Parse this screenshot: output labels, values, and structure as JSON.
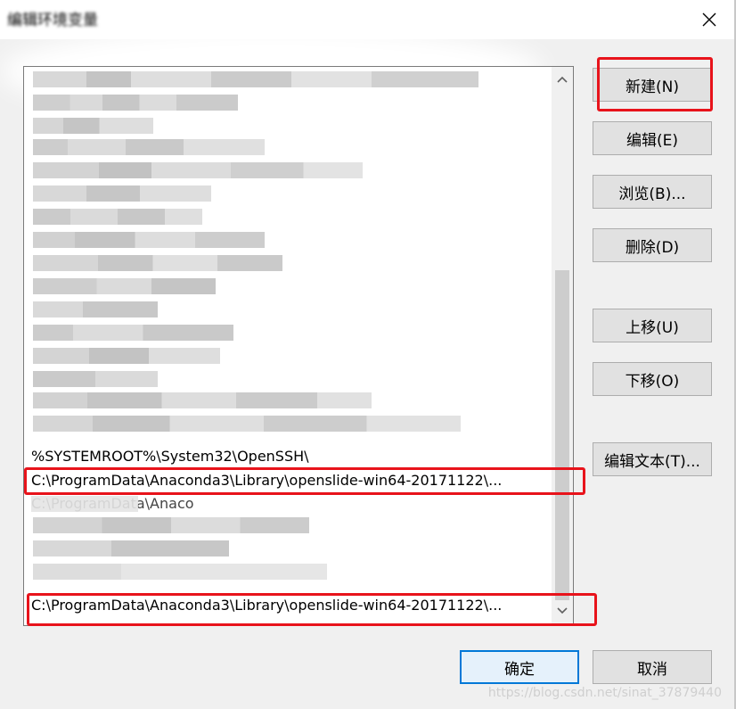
{
  "window": {
    "title": "编辑环境变量",
    "close_icon": "close-icon"
  },
  "path_list": {
    "visible_entries": [
      "%SYSTEMROOT%\\System32\\OpenSSH\\",
      "C:\\ProgramData\\Anaconda3\\Library\\openslide-win64-20171122\\...",
      "C:\\ProgramData\\Anaconda3\\Library\\openslide-win64-20171122\\..."
    ],
    "partial_entry": "C:\\ProgramData\\Anaco",
    "scroll_up_icon": "chevron-up-icon",
    "scroll_down_icon": "chevron-down-icon"
  },
  "buttons": {
    "new": "新建(N)",
    "edit": "编辑(E)",
    "browse": "浏览(B)...",
    "delete": "删除(D)",
    "move_up": "上移(U)",
    "move_down": "下移(O)",
    "edit_text": "编辑文本(T)...",
    "ok": "确定",
    "cancel": "取消"
  },
  "watermark": "https://blog.csdn.net/sinat_37879440",
  "colors": {
    "highlight": "#e8131b",
    "default_button_border": "#0078d7"
  }
}
